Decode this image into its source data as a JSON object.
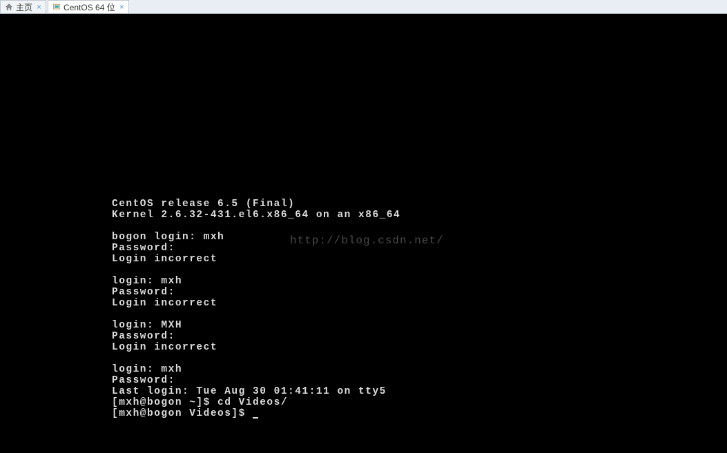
{
  "tabs": [
    {
      "label": "主页",
      "icon": "home"
    },
    {
      "label": "CentOS 64 位",
      "icon": "vm"
    }
  ],
  "terminal": {
    "lines": [
      "CentOS release 6.5 (Final)",
      "Kernel 2.6.32-431.el6.x86_64 on an x86_64",
      "",
      "bogon login: mxh",
      "Password:",
      "Login incorrect",
      "",
      "login: mxh",
      "Password:",
      "Login incorrect",
      "",
      "login: MXH",
      "Password:",
      "Login incorrect",
      "",
      "login: mxh",
      "Password:",
      "Last login: Tue Aug 30 01:41:11 on tty5",
      "[mxh@bogon ~]$ cd Videos/",
      "[mxh@bogon Videos]$ "
    ]
  },
  "watermark": "http://blog.csdn.net/"
}
